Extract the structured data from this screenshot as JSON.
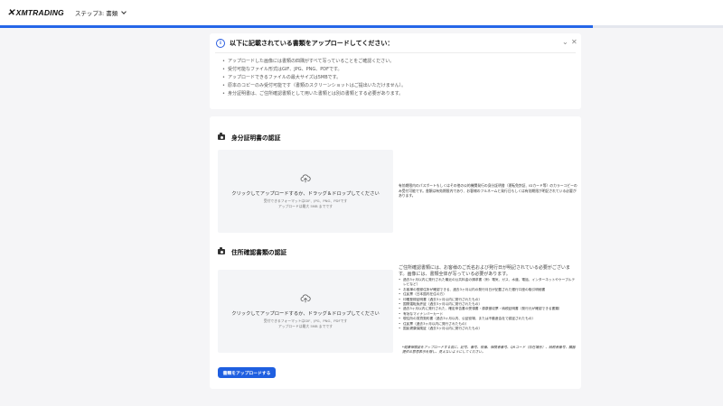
{
  "header": {
    "logo_text": "XMTRADING",
    "step_label": "ステップ3: 書類"
  },
  "progress": {
    "percent": 82
  },
  "notice": {
    "title": "以下に記載されている書類をアップロードしてください：",
    "items": [
      "アップロードした画像には書類の四隅がすべて写っていることをご確認ください。",
      "受付可能なファイル形式はGIF、JPG、PNG、PDFです。",
      "アップロードできるファイルの最大サイズは5MBです。",
      "原本のコピーのみ受付可能です（書類のスクリーンショットはご提出いただけません）。",
      "身分証明書は、ご住所確認書類として用いた書類とは別の書類とする必要があります。"
    ]
  },
  "identity": {
    "title": "身分証明書の認証",
    "dropzone_main": "クリックしてアップロードするか、ドラッグ＆ドロップしてください",
    "dropzone_formats": "受付できるフォーマットはGIF、JPG、PNG、PDFです",
    "dropzone_maxsize": "アップロードは最大 5MB までです",
    "side_text": "有効期限内のパスポートもしくはその他の公的機関発行の身分証明書（運転免許証、IDカード等）のカラーコピーのみ受付可能です。書類は有効期限内であり、お客様のフルネームと発行日もしくは有効期限が明記されている必要があります。"
  },
  "address": {
    "title": "住所確認書類の認証",
    "dropzone_main": "クリックしてアップロードするか、ドラッグ＆ドロップしてください",
    "dropzone_formats": "受付できるフォーマットはGIF、JPG、PNG、PDFです",
    "dropzone_maxsize": "アップロードは最大 5MB までです",
    "intro": "ご住所確認書類には、お客様のご氏名および発行日が明記されている必要がございます。画像には、書類全体が写っている必要があります。",
    "items": [
      "過去3ヶ月以内に発行された最近の公共料金の請求書（例：電気、ガス、水道、電話、インターネットやケーブルテレビなど）",
      "お客様の登録住所が確認できる、過去3ヶ月以内の発行月日が記載された銀行口座の取引明細書",
      "住民票（日本国内在住の方）",
      "印鑑登録証明書（過去3ヶ月以内に発行されたもの）",
      "国際運転免許証（過去3ヶ月以内に発行されたもの）",
      "過去3ヶ月以内に発行された、確定申告書の受領書・源泉徴収票・納税証明書（発行元が確認できる書類）",
      "有効なマイナンバーカード",
      "現住所の賃貸契約書（過去3ヶ月以内、公証役場、または不動産会社で認証されたもの）",
      "住民票（過去3ヶ月以内に発行されたもの）",
      "国民健康保険証（過去3ヶ月以内に発行されたもの）"
    ],
    "note": "*健康保険証をアップロードする前に、記号、番号、枝番、保険者番号、QRコード（存在場合）、納税者番号、臓器提供の意思表示を隠し、見えないようにしてください。"
  },
  "actions": {
    "upload_label": "書類をアップロードする"
  },
  "colors": {
    "accent": "#2566e8",
    "button": "#1f5fe0"
  }
}
